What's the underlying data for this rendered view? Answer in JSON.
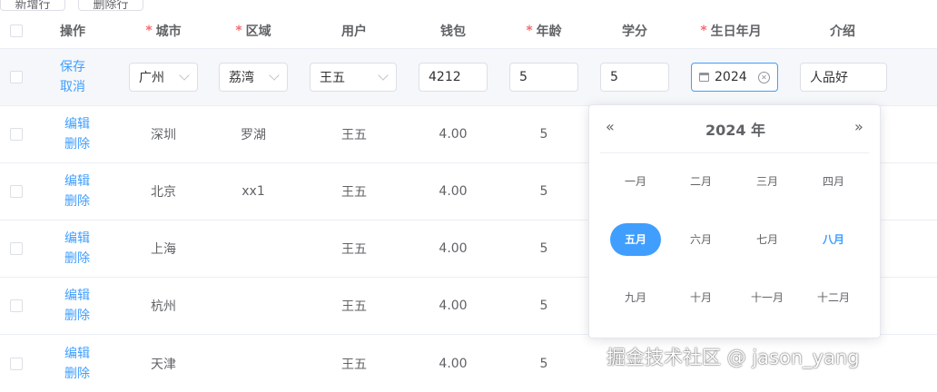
{
  "toolbar": {
    "add_row": "新增行",
    "delete_row": "删除行"
  },
  "columns": {
    "action": "操作",
    "city": "城市",
    "district": "区域",
    "user": "用户",
    "wallet": "钱包",
    "age": "年龄",
    "credit": "学分",
    "birth": "生日年月",
    "intro": "介绍"
  },
  "required_mark": "*",
  "edit_row": {
    "save": "保存",
    "cancel": "取消",
    "city": "广州",
    "district": "荔湾",
    "user": "王五",
    "wallet": "4212",
    "age": "5",
    "credit": "5",
    "birth": "2024",
    "intro": "人品好"
  },
  "row_actions": {
    "edit": "编辑",
    "delete": "删除"
  },
  "rows": [
    {
      "city": "深圳",
      "district": "罗湖",
      "user": "王五",
      "wallet": "4.00",
      "age": "5"
    },
    {
      "city": "北京",
      "district": "xx1",
      "user": "王五",
      "wallet": "4.00",
      "age": "5"
    },
    {
      "city": "上海",
      "district": "",
      "user": "王五",
      "wallet": "4.00",
      "age": "5"
    },
    {
      "city": "杭州",
      "district": "",
      "user": "王五",
      "wallet": "4.00",
      "age": "5"
    },
    {
      "city": "天津",
      "district": "",
      "user": "王五",
      "wallet": "4.00",
      "age": "5"
    }
  ],
  "datepicker": {
    "prev": "«",
    "next": "»",
    "year_title": "2024 年",
    "months": [
      "一月",
      "二月",
      "三月",
      "四月",
      "五月",
      "六月",
      "七月",
      "八月",
      "九月",
      "十月",
      "十一月",
      "十二月"
    ],
    "selected_month_index": 4,
    "today_month_index": 7
  },
  "colors": {
    "primary": "#409eff",
    "required": "#f56c6c",
    "border": "#dcdfe6"
  },
  "watermark": "掘金技术社区 @ jason_yang"
}
